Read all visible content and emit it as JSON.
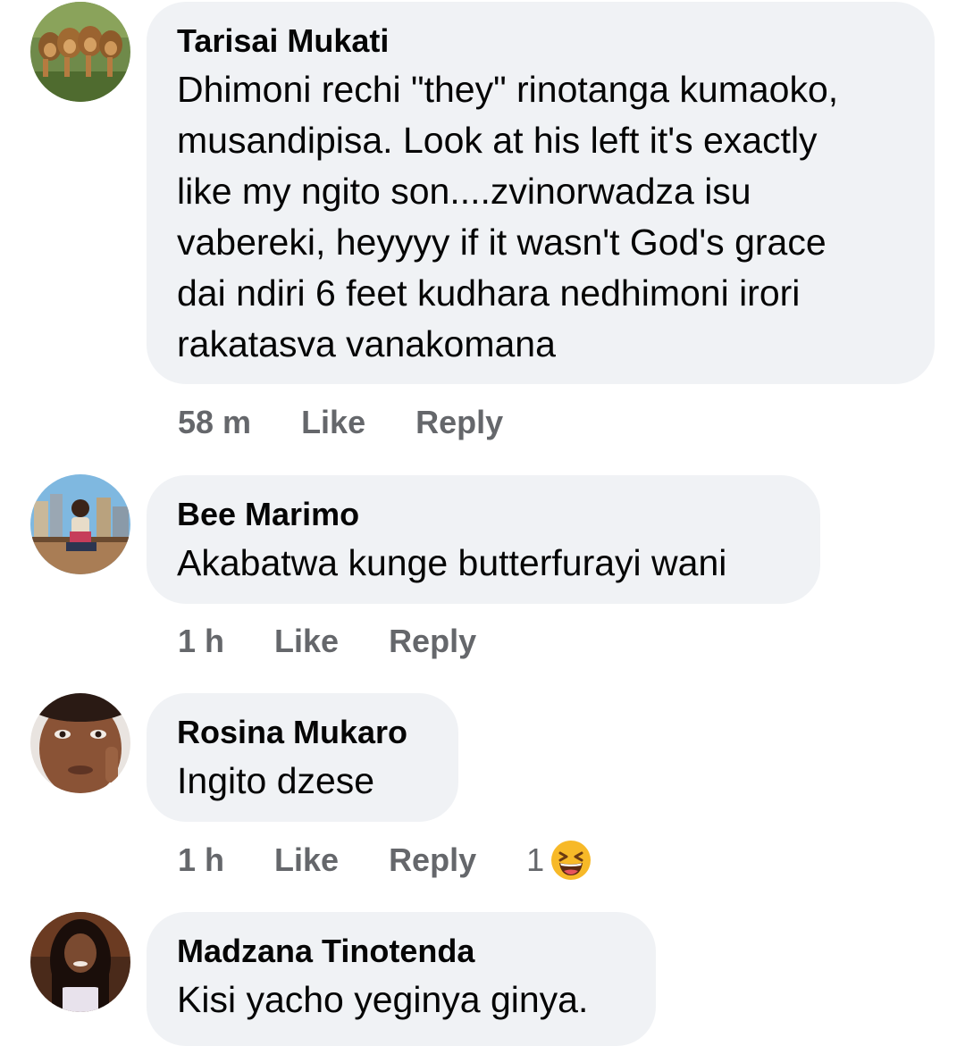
{
  "comments": [
    {
      "author": "Tarisai Mukati",
      "text_lines": [
        "Dhimoni rechi \"they\" rinotanga kumaoko,",
        "musandipisa.  Look at his left it's exactly",
        "like my ngito son....zvinorwadza isu",
        "vabereki, heyyyy if it wasn't God's grace",
        "dai ndiri 6 feet kudhara nedhimoni irori",
        "rakatasva vanakomana"
      ],
      "time": "58 m",
      "like_label": "Like",
      "reply_label": "Reply",
      "avatar_icon": "lions-avatar"
    },
    {
      "author": "Bee Marimo",
      "text_lines": [
        "Akabatwa kunge butterfurayi wani"
      ],
      "time": "1 h",
      "like_label": "Like",
      "reply_label": "Reply",
      "avatar_icon": "city-avatar"
    },
    {
      "author": "Rosina Mukaro",
      "text_lines": [
        "Ingito dzese"
      ],
      "time": "1 h",
      "like_label": "Like",
      "reply_label": "Reply",
      "reaction_count": "1",
      "reaction_icon": "laughing-emoji-icon",
      "avatar_icon": "face-avatar"
    },
    {
      "author": "Madzana Tinotenda",
      "text_lines": [
        "Kisi yacho yeginya ginya."
      ],
      "avatar_icon": "woman-avatar"
    }
  ],
  "colors": {
    "bubble": "#f0f2f5",
    "text": "#050505",
    "meta": "#65676b",
    "emoji": "#f7b928"
  }
}
